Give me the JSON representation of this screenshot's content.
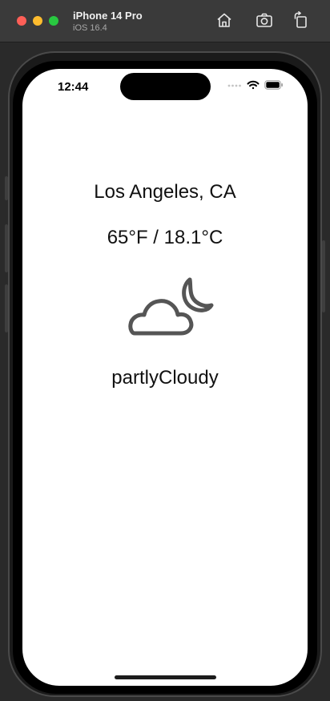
{
  "simulator": {
    "device_name": "iPhone 14 Pro",
    "os_version": "iOS 16.4",
    "toolbar_icons": [
      "home-icon",
      "screenshot-icon",
      "rotate-icon"
    ]
  },
  "status_bar": {
    "time": "12:44",
    "icons": [
      "cellular-dots-icon",
      "wifi-icon",
      "battery-icon"
    ]
  },
  "weather": {
    "city": "Los Angeles, CA",
    "temperature": "65°F / 18.1°C",
    "icon": "cloud-moon-icon",
    "condition": "partlyCloudy"
  },
  "colors": {
    "screen_background": "#ffffff",
    "icon_stroke": "#555555",
    "text": "#111111"
  }
}
